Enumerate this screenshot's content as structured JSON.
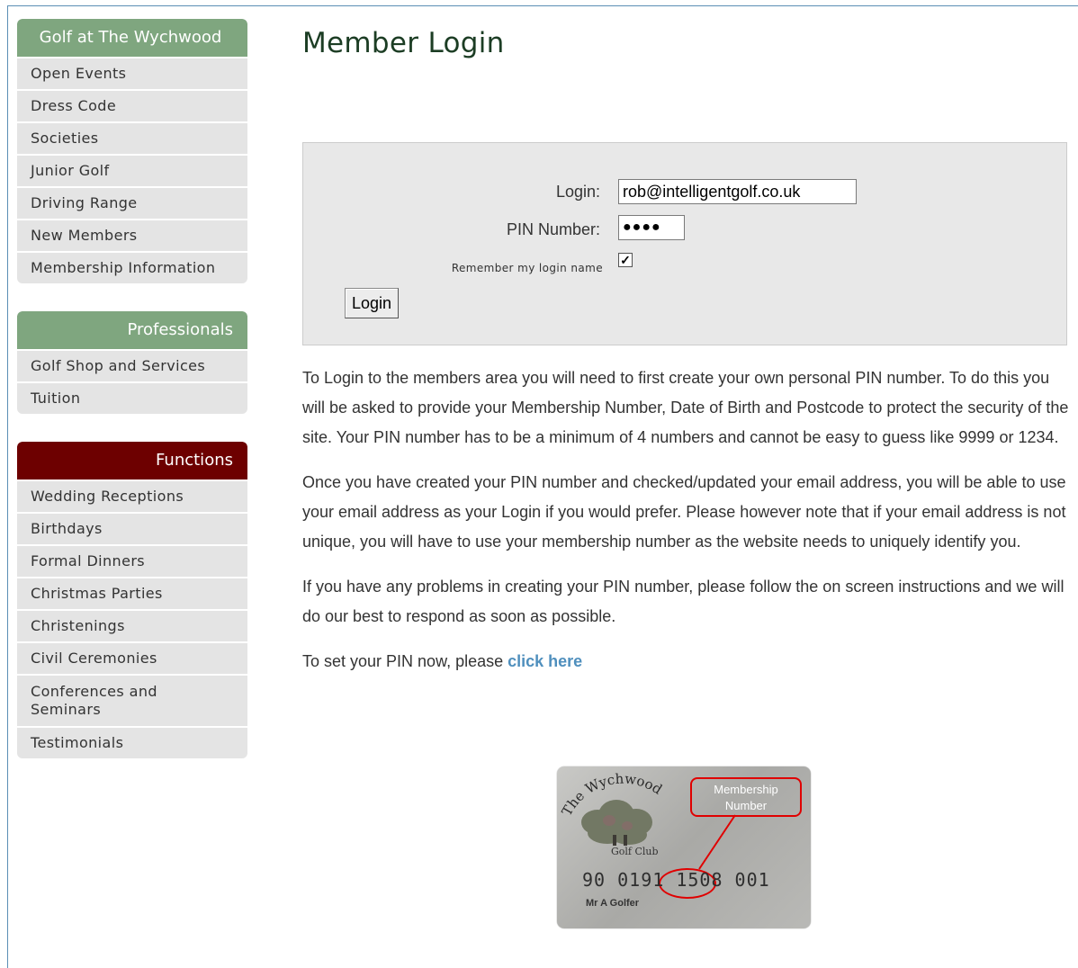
{
  "sidebar": {
    "groups": [
      {
        "title": "Golf at The Wychwood",
        "color": "#7fa67f",
        "items": [
          "Open Events",
          "Dress Code",
          "Societies",
          "Junior Golf",
          "Driving Range",
          "New Members",
          "Membership Information"
        ]
      },
      {
        "title": "Professionals",
        "color": "#7fa67f",
        "items": [
          "Golf Shop and Services",
          "Tuition"
        ]
      },
      {
        "title": "Functions",
        "color": "#6d0000",
        "items": [
          "Wedding Receptions",
          "Birthdays",
          "Formal Dinners",
          "Christmas Parties",
          "Christenings",
          "Civil Ceremonies",
          "Conferences and Seminars",
          "Testimonials"
        ]
      }
    ]
  },
  "main": {
    "title": "Member Login",
    "form": {
      "login_label": "Login:",
      "login_value": "rob@intelligentgolf.co.uk",
      "pin_label": "PIN Number:",
      "pin_value": "●●●●",
      "remember_label": "Remember my login name",
      "remember_checked": "✓",
      "submit_label": "Login"
    },
    "paragraphs": [
      "To Login to the members area you will need to first create your own personal PIN number. To do this you will be asked to provide your Membership Number, Date of Birth and Postcode to protect the security of the site. Your PIN number has to be a minimum of 4 numbers and cannot be easy to guess like 9999 or 1234.",
      "Once you have created your PIN number and checked/updated your email address, you will be able to use your email address as your Login if you would prefer. Please however note that if your email address is not unique, you will have to use your membership number as the website needs to uniquely identify you.",
      "If you have any problems in creating your PIN number, please follow the on screen instructions and we will do our best to respond as soon as possible."
    ],
    "set_pin_text": "To set your PIN now, please ",
    "set_pin_link": "click here",
    "card": {
      "club_name": "The Wychwood",
      "club_sub": "Golf Club",
      "callout_label": "Membership Number",
      "card_number": "90 0191 1508 001",
      "holder": "Mr  A  Golfer"
    }
  },
  "colors": {
    "accent_green": "#7fa67f",
    "accent_maroon": "#6d0000",
    "link": "#4f8fbd",
    "title": "#1c3d24"
  }
}
